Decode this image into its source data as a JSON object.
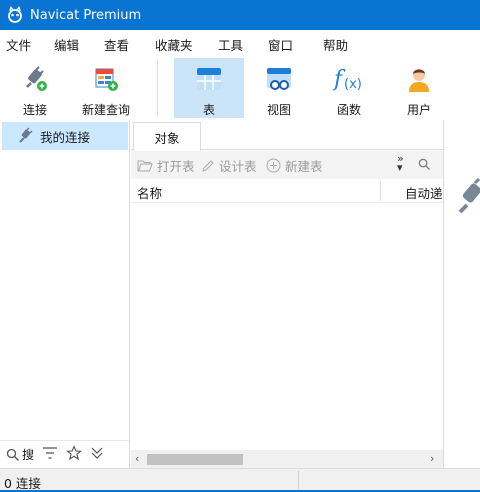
{
  "window": {
    "title": "Navicat Premium"
  },
  "menu": [
    "文件",
    "编辑",
    "查看",
    "收藏夹",
    "工具",
    "窗口",
    "帮助"
  ],
  "toolbar": {
    "connect": "连接",
    "new_query": "新建查询",
    "table": "表",
    "view": "视图",
    "function": "函数",
    "user": "用户",
    "active": "表"
  },
  "sidebar": {
    "connection_root": "我的连接",
    "search_label": "搜"
  },
  "main": {
    "tab": "对象",
    "actions": {
      "open_table": "打开表",
      "design_table": "设计表",
      "new_table": "新建表"
    },
    "columns": {
      "name": "名称",
      "auto_increment": "自动递"
    }
  },
  "status": {
    "connections": "0 连接"
  },
  "colors": {
    "accent": "#0a74d3",
    "selected": "#cce4f7",
    "tree_selected": "#cce8ff"
  }
}
